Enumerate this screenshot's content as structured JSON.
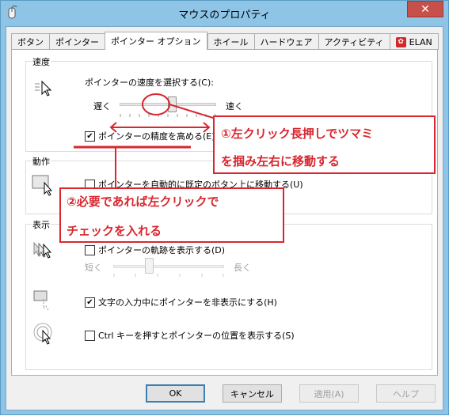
{
  "window": {
    "title": "マウスのプロパティ",
    "close_glyph": "✕"
  },
  "tabs": [
    {
      "label": "ボタン"
    },
    {
      "label": "ポインター"
    },
    {
      "label": "ポインター オプション"
    },
    {
      "label": "ホイール"
    },
    {
      "label": "ハードウェア"
    },
    {
      "label": "アクティビティ"
    },
    {
      "label": "ELAN"
    }
  ],
  "active_tab": "ポインター オプション",
  "speed": {
    "group_label": "速度",
    "select_label": "ポインターの速度を選択する(C):",
    "slow_label": "遅く",
    "fast_label": "速く",
    "slider_position": 0.55,
    "precision_label": "ポインターの精度を高める(E)",
    "precision_checked": true
  },
  "motion": {
    "group_label": "動作",
    "snap_label": "ポインターを自動的に既定のボタン上に移動する(U)",
    "snap_checked": false
  },
  "visibility": {
    "group_label": "表示",
    "trails_label": "ポインターの軌跡を表示する(D)",
    "trails_checked": false,
    "short_label": "短く",
    "long_label": "長く",
    "hide_typing_label": "文字の入力中にポインターを非表示にする(H)",
    "hide_typing_checked": true,
    "show_ctrl_label": "Ctrl キーを押すとポインターの位置を表示する(S)",
    "show_ctrl_checked": false
  },
  "buttons": {
    "ok": "OK",
    "cancel": "キャンセル",
    "apply": "適用(A)",
    "help": "ヘルプ"
  },
  "annotations": {
    "note1_line1": "①左クリック長押しでツマミ",
    "note1_line2": "を掴み左右に移動する",
    "note2_line1": "②必要であれば左クリックで",
    "note2_line2": "チェックを入れる",
    "color": "#d9262f"
  }
}
